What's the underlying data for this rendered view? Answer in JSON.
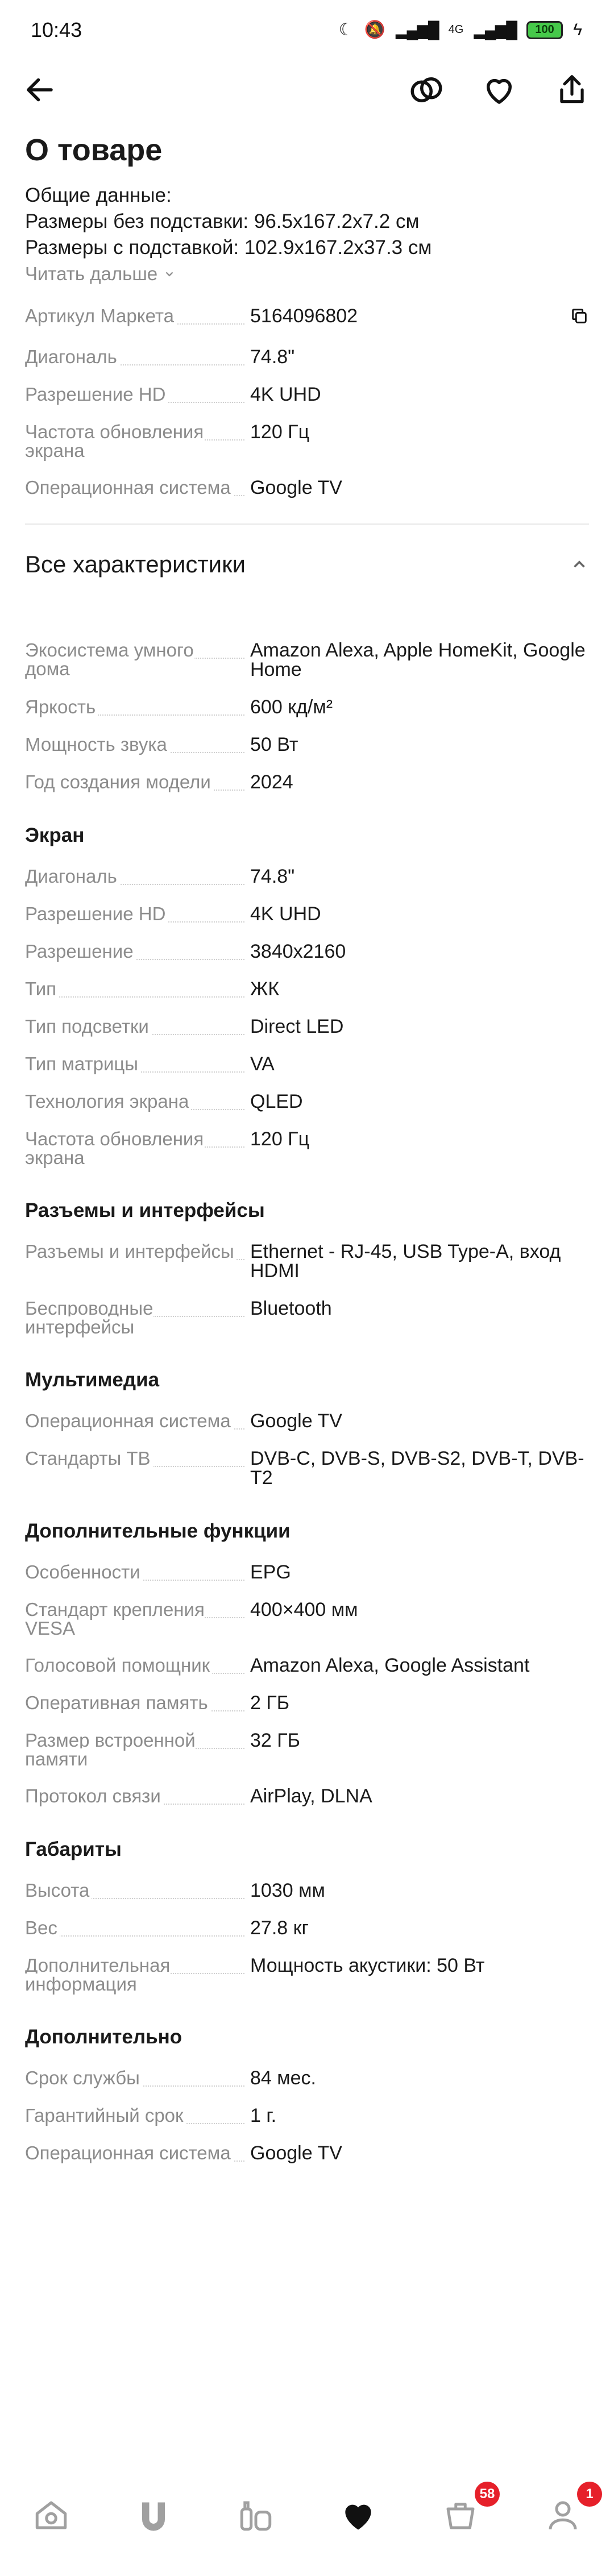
{
  "status": {
    "time": "10:43",
    "network": "4G",
    "battery": "100"
  },
  "about": {
    "title": "О товаре",
    "lines": [
      "Общие данные:",
      "Размеры без подставки: 96.5x167.2x7.2 см",
      "Размеры с подставкой: 102.9x167.2x37.3 см"
    ],
    "read_more": "Читать дальше"
  },
  "main_specs": [
    {
      "name": "Артикул Маркета",
      "value": "5164096802"
    },
    {
      "name": "Диагональ",
      "value": "74.8\""
    },
    {
      "name": "Разрешение HD",
      "value": "4K UHD"
    },
    {
      "name": "Частота обновления экрана",
      "value": "120 Гц"
    },
    {
      "name": "Операционная система",
      "value": "Google TV"
    }
  ],
  "all_specs_title": "Все характеристики",
  "general_specs": [
    {
      "name": "Экосистема умного дома",
      "value": "Amazon Alexa, Apple HomeKit, Google Home"
    },
    {
      "name": "Яркость",
      "value": "600 кд/м²"
    },
    {
      "name": "Мощность звука",
      "value": "50 Вт"
    },
    {
      "name": "Год создания модели",
      "value": "2024"
    }
  ],
  "groups": [
    {
      "title": "Экран",
      "rows": [
        {
          "name": "Диагональ",
          "value": "74.8\""
        },
        {
          "name": "Разрешение HD",
          "value": "4K UHD"
        },
        {
          "name": "Разрешение",
          "value": "3840x2160"
        },
        {
          "name": "Тип",
          "value": "ЖК"
        },
        {
          "name": "Тип подсветки",
          "value": "Direct LED"
        },
        {
          "name": "Тип матрицы",
          "value": "VA"
        },
        {
          "name": "Технология экрана",
          "value": "QLED"
        },
        {
          "name": "Частота обновления экрана",
          "value": "120 Гц"
        }
      ]
    },
    {
      "title": "Разъемы и интерфейсы",
      "rows": [
        {
          "name": "Разъемы и интерфейсы",
          "value": "Ethernet - RJ-45, USB Type-A, вход HDMI"
        },
        {
          "name": "Беспроводные интерфейсы",
          "value": "Bluetooth"
        }
      ]
    },
    {
      "title": "Мультимедиа",
      "rows": [
        {
          "name": "Операционная система",
          "value": "Google TV"
        },
        {
          "name": "Стандарты ТВ",
          "value": "DVB-C, DVB-S, DVB-S2, DVB-T, DVB-T2"
        }
      ]
    },
    {
      "title": "Дополнительные функции",
      "rows": [
        {
          "name": "Особенности",
          "value": "EPG"
        },
        {
          "name": "Стандарт крепления VESA",
          "value": "400×400 мм"
        },
        {
          "name": "Голосовой помощник",
          "value": "Amazon Alexa, Google Assistant"
        },
        {
          "name": "Оперативная память",
          "value": "2 ГБ"
        },
        {
          "name": "Размер встроенной памяти",
          "value": "32 ГБ"
        },
        {
          "name": "Протокол связи",
          "value": "AirPlay, DLNA"
        }
      ]
    },
    {
      "title": "Габариты",
      "rows": [
        {
          "name": "Высота",
          "value": "1030 мм"
        },
        {
          "name": "Вес",
          "value": "27.8 кг"
        },
        {
          "name": "Дополнительная информация",
          "value": "Мощность акустики: 50 Вт"
        }
      ]
    },
    {
      "title": "Дополнительно",
      "rows": [
        {
          "name": "Срок службы",
          "value": "84 мес."
        },
        {
          "name": "Гарантийный срок",
          "value": "1 г."
        },
        {
          "name": "Операционная система",
          "value": "Google TV"
        }
      ]
    }
  ],
  "tabbar": {
    "cart_badge": "58",
    "profile_badge": "1",
    "icons": [
      "home-icon",
      "split-icon",
      "catalog-icon",
      "favorites-icon",
      "cart-icon",
      "profile-icon"
    ]
  }
}
